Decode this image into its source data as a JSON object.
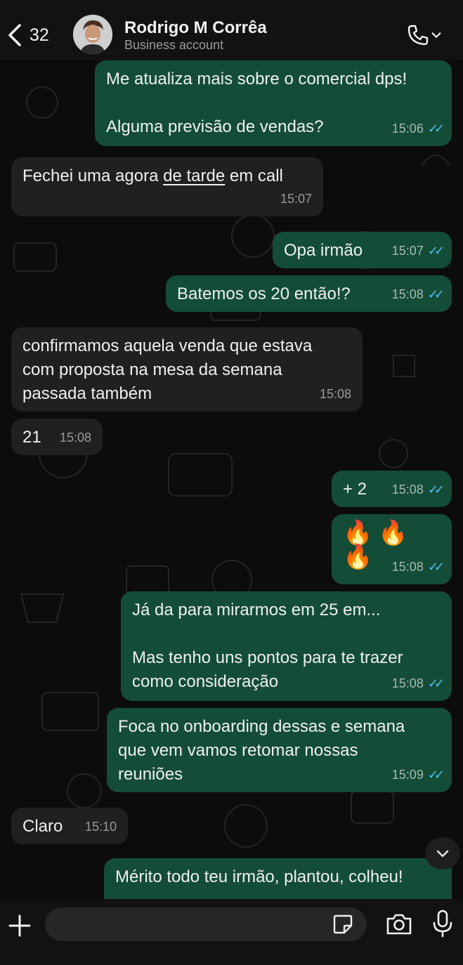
{
  "header": {
    "back_count": "32",
    "contact_name": "Rodrigo M Corrêa",
    "subtitle": "Business account"
  },
  "messages": [
    {
      "dir": "out",
      "text": "Me atualiza mais sobre o comercial dps!\n\nAlguma previsão de vendas?",
      "time": "15:06",
      "ticks": "✓✓"
    },
    {
      "dir": "in",
      "text_pre": "Fechei uma agora ",
      "text_link": "de tarde",
      "text_post": " em call",
      "time": "15:07"
    },
    {
      "dir": "out",
      "text": "Opa irmão",
      "time": "15:07",
      "ticks": "✓✓"
    },
    {
      "dir": "out",
      "text": "Batemos os 20 então!?",
      "time": "15:08",
      "ticks": "✓✓"
    },
    {
      "dir": "in",
      "text": "confirmamos aquela venda que estava\ncom proposta na mesa da semana\npassada também",
      "time": "15:08"
    },
    {
      "dir": "in",
      "text": "21",
      "time": "15:08"
    },
    {
      "dir": "out",
      "text": "+ 2",
      "time": "15:08",
      "ticks": "✓✓"
    },
    {
      "dir": "out",
      "text": "🔥🔥🔥",
      "time": "15:08",
      "ticks": "✓✓"
    },
    {
      "dir": "out",
      "text": "Já da para mirarmos em 25 em...\n\nMas tenho uns pontos para te trazer\ncomo consideração",
      "time": "15:08",
      "ticks": "✓✓"
    },
    {
      "dir": "out",
      "text": "Foca no onboarding dessas e semana\nque vem vamos retomar nossas\nreuniões",
      "time": "15:09",
      "ticks": "✓✓"
    },
    {
      "dir": "in",
      "text": "Claro",
      "time": "15:10"
    },
    {
      "dir": "out",
      "text": "Mérito todo teu irmão, plantou, colheu!"
    }
  ],
  "composer": {
    "placeholder": ""
  },
  "colors": {
    "outgoing_bubble": "#144d37",
    "incoming_bubble": "#202020",
    "read_ticks": "#53bdeb"
  },
  "icons": [
    "back-chevron-icon",
    "phone-icon",
    "chevron-down-icon",
    "plus-icon",
    "sticker-icon",
    "camera-icon",
    "mic-icon"
  ]
}
